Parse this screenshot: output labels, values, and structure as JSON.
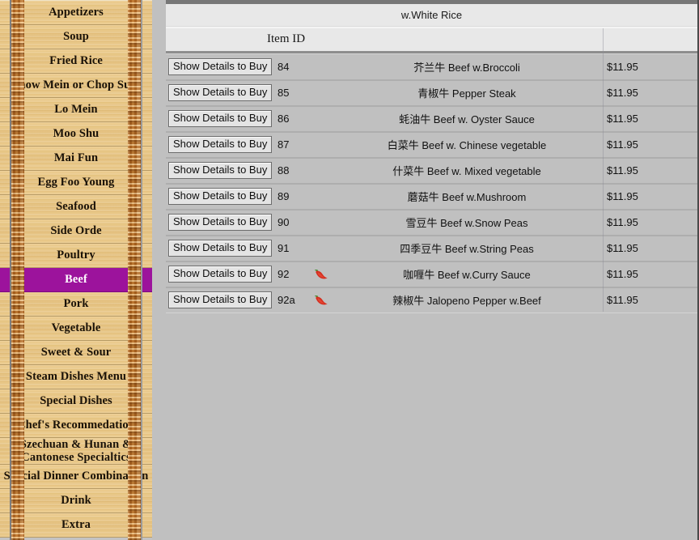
{
  "sidebar": {
    "items": [
      {
        "label": "Appetizers",
        "selected": false
      },
      {
        "label": "Soup",
        "selected": false
      },
      {
        "label": "Fried Rice",
        "selected": false
      },
      {
        "label": "Chow Mein or Chop Suey",
        "selected": false
      },
      {
        "label": "Lo Mein",
        "selected": false
      },
      {
        "label": "Moo Shu",
        "selected": false
      },
      {
        "label": "Mai Fun",
        "selected": false
      },
      {
        "label": "Egg Foo Young",
        "selected": false
      },
      {
        "label": "Seafood",
        "selected": false
      },
      {
        "label": "Side Orde",
        "selected": false
      },
      {
        "label": "Poultry",
        "selected": false
      },
      {
        "label": "Beef",
        "selected": true
      },
      {
        "label": "Pork",
        "selected": false
      },
      {
        "label": "Vegetable",
        "selected": false
      },
      {
        "label": "Sweet & Sour",
        "selected": false
      },
      {
        "label": "Steam Dishes Menu",
        "selected": false
      },
      {
        "label": "Special Dishes",
        "selected": false
      },
      {
        "label": "Chef's Recommedation",
        "selected": false
      },
      {
        "label": "Szechuan & Hunan & Cantonese Specialtics",
        "selected": false,
        "wrap": true
      },
      {
        "label": "Special Dinner Combination",
        "selected": false
      },
      {
        "label": "Drink",
        "selected": false
      },
      {
        "label": "Extra",
        "selected": false
      }
    ]
  },
  "main": {
    "title": "w.White Rice",
    "column_headers": {
      "item_id": "Item ID"
    },
    "button_label": "Show Details to Buy",
    "rows": [
      {
        "id": "84",
        "spicy": false,
        "name": "芥兰牛 Beef w.Broccoli",
        "price": "$11.95"
      },
      {
        "id": "85",
        "spicy": false,
        "name": "青椒牛 Pepper Steak",
        "price": "$11.95"
      },
      {
        "id": "86",
        "spicy": false,
        "name": "蚝油牛 Beef w. Oyster Sauce",
        "price": "$11.95"
      },
      {
        "id": "87",
        "spicy": false,
        "name": "白菜牛 Beef w. Chinese vegetable",
        "price": "$11.95"
      },
      {
        "id": "88",
        "spicy": false,
        "name": "什菜牛 Beef w. Mixed vegetable",
        "price": "$11.95"
      },
      {
        "id": "89",
        "spicy": false,
        "name": "蘑菇牛 Beef w.Mushroom",
        "price": "$11.95"
      },
      {
        "id": "90",
        "spicy": false,
        "name": "雪豆牛 Beef w.Snow Peas",
        "price": "$11.95"
      },
      {
        "id": "91",
        "spicy": false,
        "name": "四季豆牛 Beef w.String Peas",
        "price": "$11.95"
      },
      {
        "id": "92",
        "spicy": true,
        "name": "咖喱牛 Beef w.Curry Sauce",
        "price": "$11.95"
      },
      {
        "id": "92a",
        "spicy": true,
        "name": "辣椒牛 Jalopeno Pepper w.Beef",
        "price": "$11.95"
      }
    ]
  },
  "colors": {
    "selected_menu_bg": "#9c139c",
    "menu_wood": "#e9c884",
    "panel_gray": "#c0c0c0",
    "header_gray": "#e8e8e8",
    "chili_red": "#d42e1f",
    "chili_stem_green": "#3f8c2a"
  },
  "icons": {
    "spicy": "chili-pepper-icon"
  }
}
